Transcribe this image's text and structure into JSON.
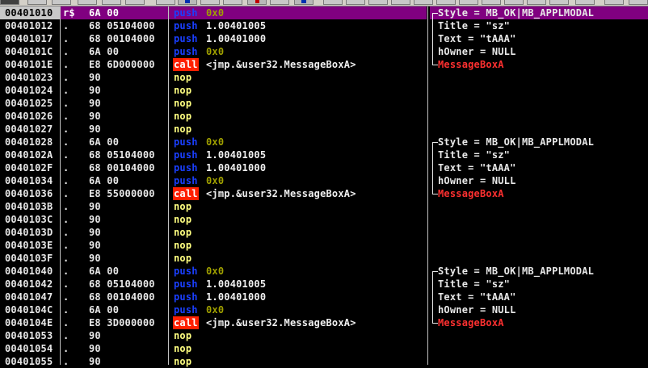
{
  "colors": {
    "background": "#000000",
    "selection": "#800080",
    "push": "#1a3fff",
    "nop": "#ffff80",
    "call_bg": "#ff2000",
    "immediate": "#a0a000",
    "function_name": "#ff3030"
  },
  "rows": [
    {
      "addr": "00401010",
      "mark": "r$",
      "hex": "6A 00",
      "mnem": "push",
      "operand": "0x0",
      "comment": "Style = MB_OK|MB_APPLMODAL",
      "bracket": "top",
      "selected": true
    },
    {
      "addr": "00401012",
      "mark": ".",
      "hex": "68 05104000",
      "mnem": "push",
      "operand": "1.00401005",
      "comment": "Title = \"sz\"",
      "bracket": "mid"
    },
    {
      "addr": "00401017",
      "mark": ".",
      "hex": "68 00104000",
      "mnem": "push",
      "operand": "1.00401000",
      "comment": "Text = \"tAAA\"",
      "bracket": "mid"
    },
    {
      "addr": "0040101C",
      "mark": ".",
      "hex": "6A 00",
      "mnem": "push",
      "operand": "0x0",
      "comment": "hOwner = NULL",
      "bracket": "mid"
    },
    {
      "addr": "0040101E",
      "mark": ".",
      "hex": "E8 6D000000",
      "mnem": "call",
      "operand": "<jmp.&user32.MessageBoxA>",
      "comment": "MessageBoxA",
      "bracket": "bot"
    },
    {
      "addr": "00401023",
      "mark": ".",
      "hex": "90",
      "mnem": "nop",
      "operand": "",
      "comment": ""
    },
    {
      "addr": "00401024",
      "mark": ".",
      "hex": "90",
      "mnem": "nop",
      "operand": "",
      "comment": ""
    },
    {
      "addr": "00401025",
      "mark": ".",
      "hex": "90",
      "mnem": "nop",
      "operand": "",
      "comment": ""
    },
    {
      "addr": "00401026",
      "mark": ".",
      "hex": "90",
      "mnem": "nop",
      "operand": "",
      "comment": ""
    },
    {
      "addr": "00401027",
      "mark": ".",
      "hex": "90",
      "mnem": "nop",
      "operand": "",
      "comment": ""
    },
    {
      "addr": "00401028",
      "mark": ".",
      "hex": "6A 00",
      "mnem": "push",
      "operand": "0x0",
      "comment": "Style = MB_OK|MB_APPLMODAL",
      "bracket": "top"
    },
    {
      "addr": "0040102A",
      "mark": ".",
      "hex": "68 05104000",
      "mnem": "push",
      "operand": "1.00401005",
      "comment": "Title = \"sz\"",
      "bracket": "mid"
    },
    {
      "addr": "0040102F",
      "mark": ".",
      "hex": "68 00104000",
      "mnem": "push",
      "operand": "1.00401000",
      "comment": "Text = \"tAAA\"",
      "bracket": "mid"
    },
    {
      "addr": "00401034",
      "mark": ".",
      "hex": "6A 00",
      "mnem": "push",
      "operand": "0x0",
      "comment": "hOwner = NULL",
      "bracket": "mid"
    },
    {
      "addr": "00401036",
      "mark": ".",
      "hex": "E8 55000000",
      "mnem": "call",
      "operand": "<jmp.&user32.MessageBoxA>",
      "comment": "MessageBoxA",
      "bracket": "bot"
    },
    {
      "addr": "0040103B",
      "mark": ".",
      "hex": "90",
      "mnem": "nop",
      "operand": "",
      "comment": ""
    },
    {
      "addr": "0040103C",
      "mark": ".",
      "hex": "90",
      "mnem": "nop",
      "operand": "",
      "comment": ""
    },
    {
      "addr": "0040103D",
      "mark": ".",
      "hex": "90",
      "mnem": "nop",
      "operand": "",
      "comment": ""
    },
    {
      "addr": "0040103E",
      "mark": ".",
      "hex": "90",
      "mnem": "nop",
      "operand": "",
      "comment": ""
    },
    {
      "addr": "0040103F",
      "mark": ".",
      "hex": "90",
      "mnem": "nop",
      "operand": "",
      "comment": ""
    },
    {
      "addr": "00401040",
      "mark": ".",
      "hex": "6A 00",
      "mnem": "push",
      "operand": "0x0",
      "comment": "Style = MB_OK|MB_APPLMODAL",
      "bracket": "top"
    },
    {
      "addr": "00401042",
      "mark": ".",
      "hex": "68 05104000",
      "mnem": "push",
      "operand": "1.00401005",
      "comment": "Title = \"sz\"",
      "bracket": "mid"
    },
    {
      "addr": "00401047",
      "mark": ".",
      "hex": "68 00104000",
      "mnem": "push",
      "operand": "1.00401000",
      "comment": "Text = \"tAAA\"",
      "bracket": "mid"
    },
    {
      "addr": "0040104C",
      "mark": ".",
      "hex": "6A 00",
      "mnem": "push",
      "operand": "0x0",
      "comment": "hOwner = NULL",
      "bracket": "mid"
    },
    {
      "addr": "0040104E",
      "mark": ".",
      "hex": "E8 3D000000",
      "mnem": "call",
      "operand": "<jmp.&user32.MessageBoxA>",
      "comment": "MessageBoxA",
      "bracket": "bot"
    },
    {
      "addr": "00401053",
      "mark": ".",
      "hex": "90",
      "mnem": "nop",
      "operand": "",
      "comment": ""
    },
    {
      "addr": "00401054",
      "mark": ".",
      "hex": "90",
      "mnem": "nop",
      "operand": "",
      "comment": ""
    },
    {
      "addr": "00401055",
      "mark": ".",
      "hex": "90",
      "mnem": "nop",
      "operand": "",
      "comment": ""
    }
  ]
}
